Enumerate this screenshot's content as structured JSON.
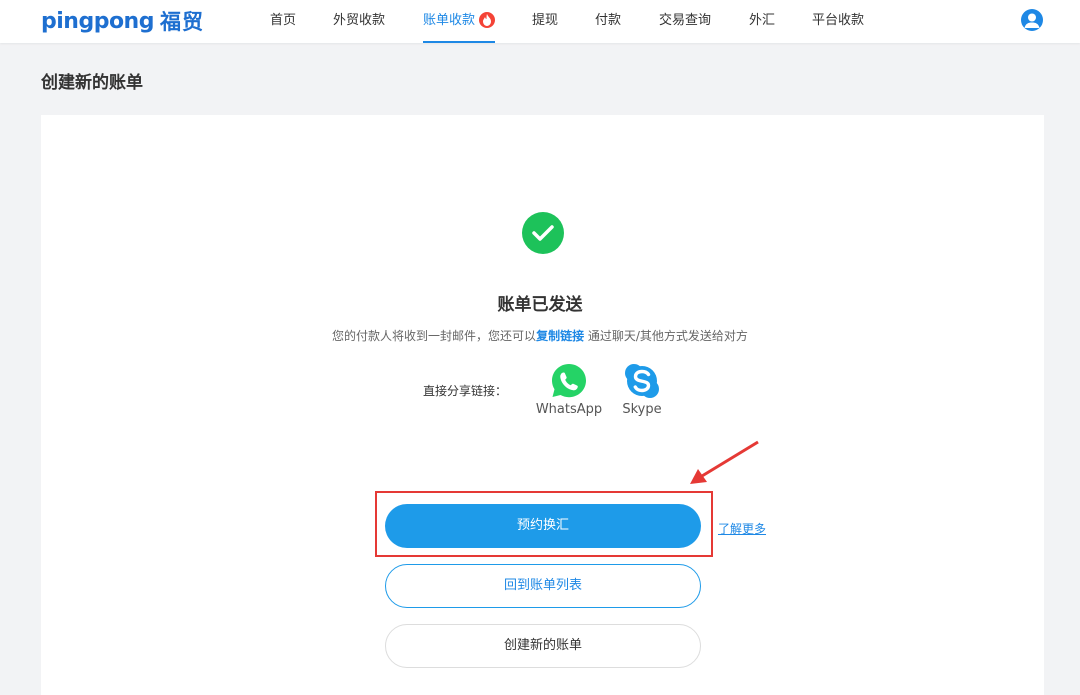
{
  "brand": {
    "logo_text": "pingpong",
    "logo_cn": "福贸"
  },
  "nav": {
    "items": [
      {
        "label": "首页"
      },
      {
        "label": "外贸收款"
      },
      {
        "label": "账单收款",
        "active": true
      },
      {
        "label": "提现"
      },
      {
        "label": "付款"
      },
      {
        "label": "交易查询"
      },
      {
        "label": "外汇"
      },
      {
        "label": "平台收款"
      }
    ]
  },
  "page": {
    "title": "创建新的账单"
  },
  "result": {
    "title": "账单已发送",
    "desc_before": "您的付款人将收到一封邮件，您还可以",
    "desc_link": "复制链接",
    "desc_after": " 通过聊天/其他方式发送给对方"
  },
  "share": {
    "label": "直接分享链接：",
    "apps": [
      {
        "name": "WhatsApp",
        "icon": "whatsapp-icon"
      },
      {
        "name": "Skype",
        "icon": "skype-icon"
      }
    ]
  },
  "actions": {
    "primary": "预约换汇",
    "learn_more": "了解更多",
    "back": "回到账单列表",
    "create": "创建新的账单"
  },
  "colors": {
    "accent": "#1e9be9",
    "success": "#1dc25a",
    "highlight": "#e53935"
  }
}
